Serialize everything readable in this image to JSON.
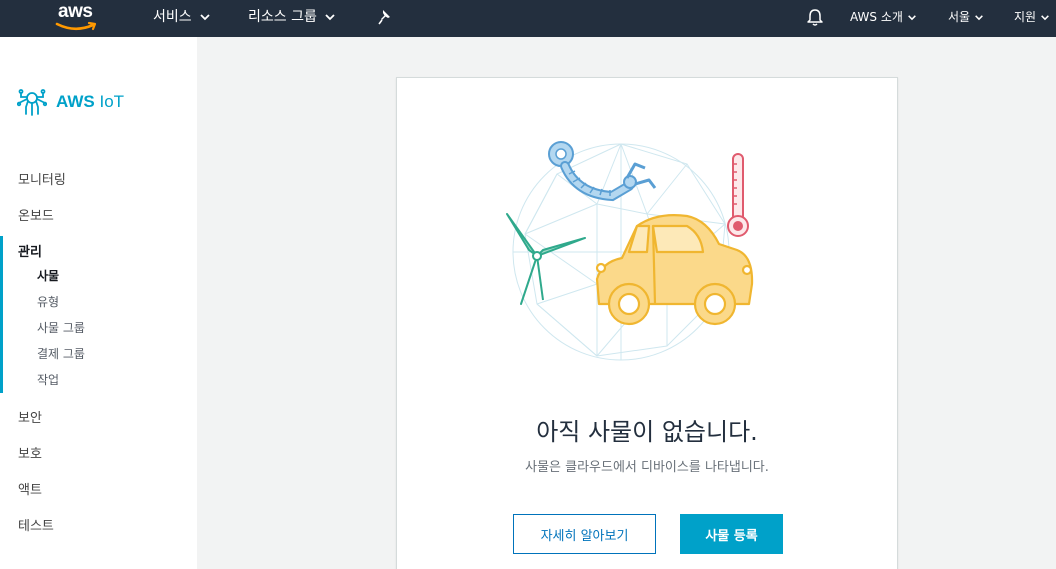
{
  "topnav": {
    "logo_text": "aws",
    "services_label": "서비스",
    "resource_groups_label": "리소스 그룹",
    "pin_icon": "pin-icon",
    "bell_icon": "bell-icon",
    "about_label": "AWS 소개",
    "region_label": "서울",
    "support_label": "지원"
  },
  "sidebar": {
    "brand_aws": "AWS",
    "brand_iot": "IoT",
    "items": {
      "monitoring": "모니터링",
      "onboard": "온보드",
      "manage": "관리",
      "things": "사물",
      "types": "유형",
      "thing_groups": "사물 그룹",
      "billing_groups": "결제 그룹",
      "jobs": "작업",
      "security": "보안",
      "defend": "보호",
      "act": "액트",
      "test": "테스트"
    }
  },
  "main": {
    "title": "아직 사물이 없습니다.",
    "subtitle": "사물은 클라우드에서 디바이스를 나타냅니다.",
    "learn_more": "자세히 알아보기",
    "register": "사물 등록"
  },
  "colors": {
    "nav_bg": "#232f3e",
    "accent": "#00a1c9",
    "link": "#0073bb"
  }
}
